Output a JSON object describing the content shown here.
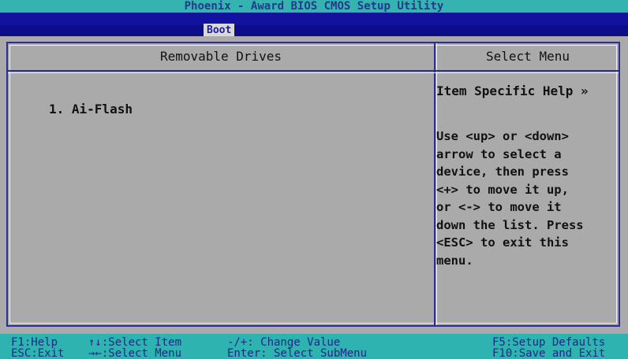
{
  "title": "Phoenix - Award BIOS CMOS Setup Utility",
  "menu": {
    "active_tab": "Boot"
  },
  "panel": {
    "left_header": "Removable Drives",
    "right_header": "Select Menu",
    "items": [
      "1. Ai-Flash"
    ],
    "help_title": "Item Specific Help »",
    "help_lines": [
      "Use <up> or <down>",
      "arrow to select a",
      "device, then press",
      "<+> to move it up,",
      "or <-> to move it",
      "down the list. Press",
      "<ESC> to exit this",
      "menu."
    ]
  },
  "keys": {
    "f1": "F1:Help",
    "esc": "ESC:Exit",
    "select_item": "↑↓:Select Item",
    "select_menu": "→←:Select Menu",
    "change_value": "-/+: Change Value",
    "enter": "Enter: Select SubMenu",
    "f5": "F5:Setup Defaults",
    "f10": "F10:Save and Exit"
  },
  "colors": {
    "title_bg": "#34b3b0",
    "menubar_bg": "#12129e",
    "panel_bg": "#aaaaaa",
    "border": "#2b2b9a",
    "keybar_bg": "#2fb3b0"
  }
}
